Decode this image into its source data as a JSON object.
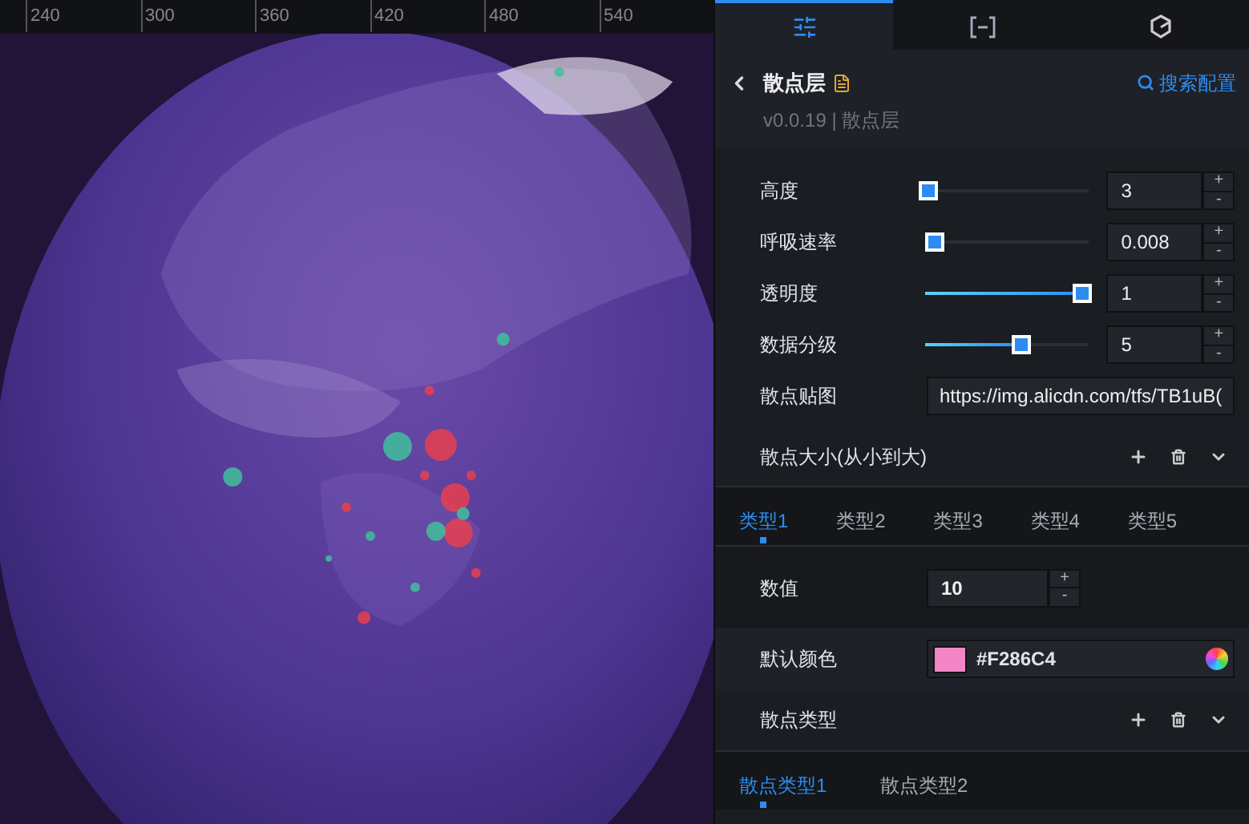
{
  "ruler": {
    "ticks": [
      "240",
      "300",
      "360",
      "420",
      "480",
      "540"
    ]
  },
  "panel": {
    "tabs": [
      {
        "kind": "sliders",
        "selected": true
      },
      {
        "kind": "bracket",
        "selected": false
      },
      {
        "kind": "cube",
        "selected": false
      }
    ],
    "header": {
      "title": "散点层",
      "subtitle": "v0.0.19 | 散点层",
      "search_link": "搜索配置"
    },
    "fields": [
      {
        "kind": "slider",
        "label": "高度",
        "level": 0,
        "value": "3",
        "steppers": [
          "+",
          "-"
        ]
      },
      {
        "kind": "slider",
        "label": "呼吸速率",
        "level": 0.04,
        "value": "0.008",
        "steppers": [
          "+",
          "-"
        ]
      },
      {
        "kind": "slider",
        "label": "透明度",
        "level": 1,
        "value": "1",
        "steppers": [
          "+",
          "-"
        ]
      },
      {
        "kind": "slider",
        "label": "数据分级",
        "level": 0.6,
        "value": "5",
        "steppers": [
          "+",
          "-"
        ]
      },
      {
        "kind": "text",
        "label": "散点贴图",
        "value": "https://img.alicdn.com/tfs/TB1uB("
      }
    ],
    "size_section": {
      "title": "散点大小(从小到大)"
    },
    "type_tabs": [
      {
        "label": "类型1",
        "selected": true
      },
      {
        "label": "类型2",
        "selected": false
      },
      {
        "label": "类型3",
        "selected": false
      },
      {
        "label": "类型4",
        "selected": false
      },
      {
        "label": "类型5",
        "selected": false
      }
    ],
    "value_field": {
      "label": "数值",
      "value": "10",
      "steppers": [
        "+",
        "-"
      ]
    },
    "color_field": {
      "label": "默认颜色",
      "value": "#F286C4",
      "color": "#f286c4"
    },
    "scatter_type_section": {
      "title": "散点类型"
    },
    "scatter_type_tabs": [
      {
        "label": "散点类型1",
        "selected": true
      },
      {
        "label": "散点类型2",
        "selected": false
      }
    ]
  }
}
